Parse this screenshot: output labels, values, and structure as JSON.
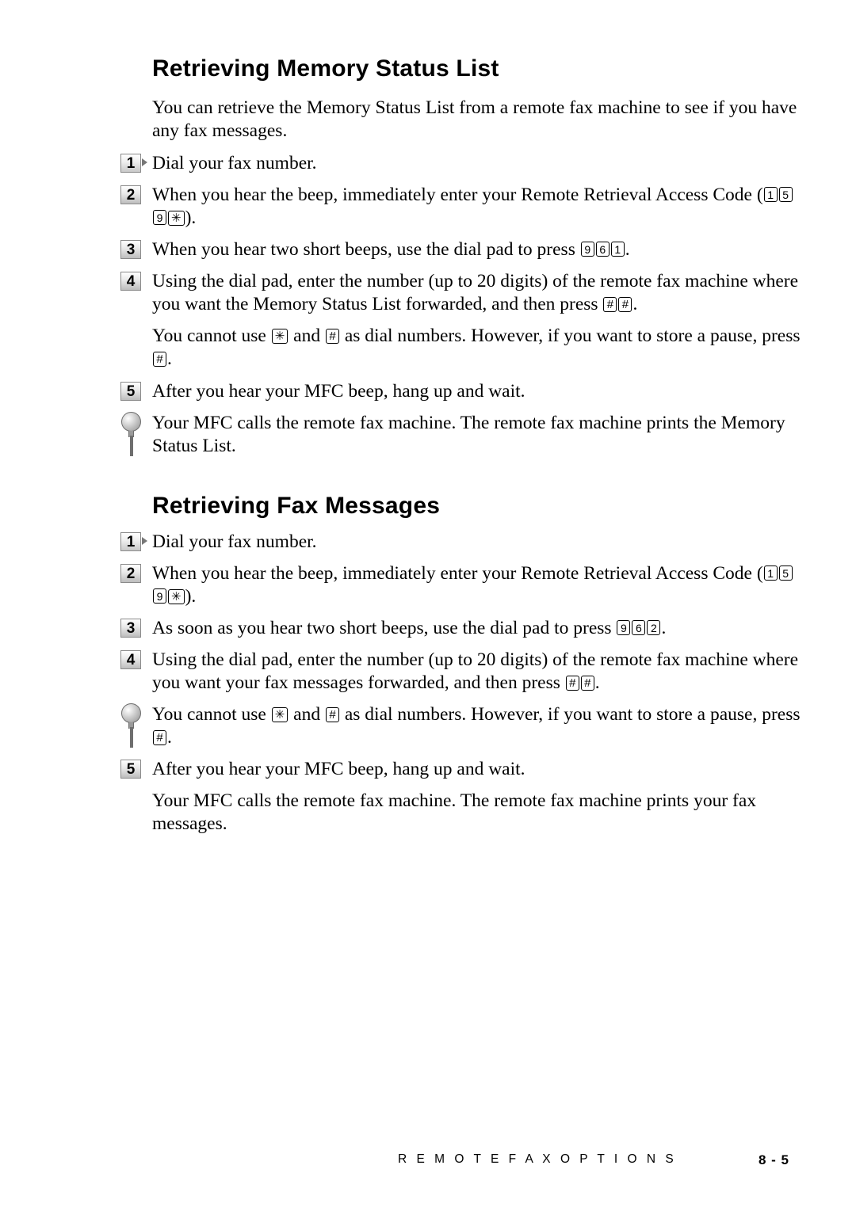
{
  "document": {
    "sections": [
      {
        "title": "Retrieving Memory Status List",
        "intro": "You can retrieve the Memory Status List from a remote fax machine to see if you have any fax messages.",
        "steps": [
          {
            "num": "1",
            "text_before": "Dial your fax number."
          },
          {
            "num": "2",
            "text_before": "When you hear the beep, immediately enter your Remote Retrieval Access Code (",
            "keys": [
              "1",
              "5",
              "9",
              "✳"
            ],
            "text_after": ")."
          },
          {
            "num": "3",
            "text_before": "When you hear two short beeps, use the dial pad to press ",
            "keys": [
              "9",
              "6",
              "1"
            ],
            "text_after": "."
          },
          {
            "num": "4",
            "text_before": "Using the dial pad, enter the number (up to 20 digits) of the remote fax machine where you want the Memory Status List forwarded, and then press ",
            "keys": [
              "#",
              "#"
            ],
            "text_after": "."
          },
          {
            "num": "5",
            "text_before": "After you hear your MFC beep, hang up and wait."
          }
        ],
        "inline_note": {
          "part1": "You cannot use ",
          "key1": "✳",
          "part2": " and ",
          "key2": "#",
          "part3": " as dial numbers. However, if you want to store a pause, press ",
          "key3": "#",
          "part4": "."
        },
        "bulb_note": "Your MFC calls the remote fax machine. The remote fax machine prints the Memory Status List."
      },
      {
        "title": "Retrieving Fax Messages",
        "steps": [
          {
            "num": "1",
            "text_before": "Dial your fax number."
          },
          {
            "num": "2",
            "text_before": "When you hear the beep, immediately enter your Remote Retrieval Access Code (",
            "keys": [
              "1",
              "5",
              "9",
              "✳"
            ],
            "text_after": ")."
          },
          {
            "num": "3",
            "text_before": "As soon as you hear two short beeps, use the dial pad to press ",
            "keys": [
              "9",
              "6",
              "2"
            ],
            "text_after": "."
          },
          {
            "num": "4",
            "text_before": "Using the dial pad, enter the number (up to 20 digits) of the remote fax machine where you want your fax messages forwarded, and then press ",
            "keys": [
              "#",
              "#"
            ],
            "text_after": "."
          },
          {
            "num": "5",
            "text_before": "After you hear your MFC beep, hang up and wait."
          }
        ],
        "bulb_note": {
          "part1": "You cannot use ",
          "key1": "✳",
          "part2": " and ",
          "key2": "#",
          "part3": " as dial numbers.  However, if you want to store a pause, press ",
          "key3": "#",
          "part4": "."
        },
        "closing": "Your MFC calls the remote fax machine. The remote fax machine prints your fax messages."
      }
    ]
  },
  "footer": {
    "chapter_label": "R E M O T E    F A X    O P T I O N S",
    "page_number": "8 - 5"
  }
}
